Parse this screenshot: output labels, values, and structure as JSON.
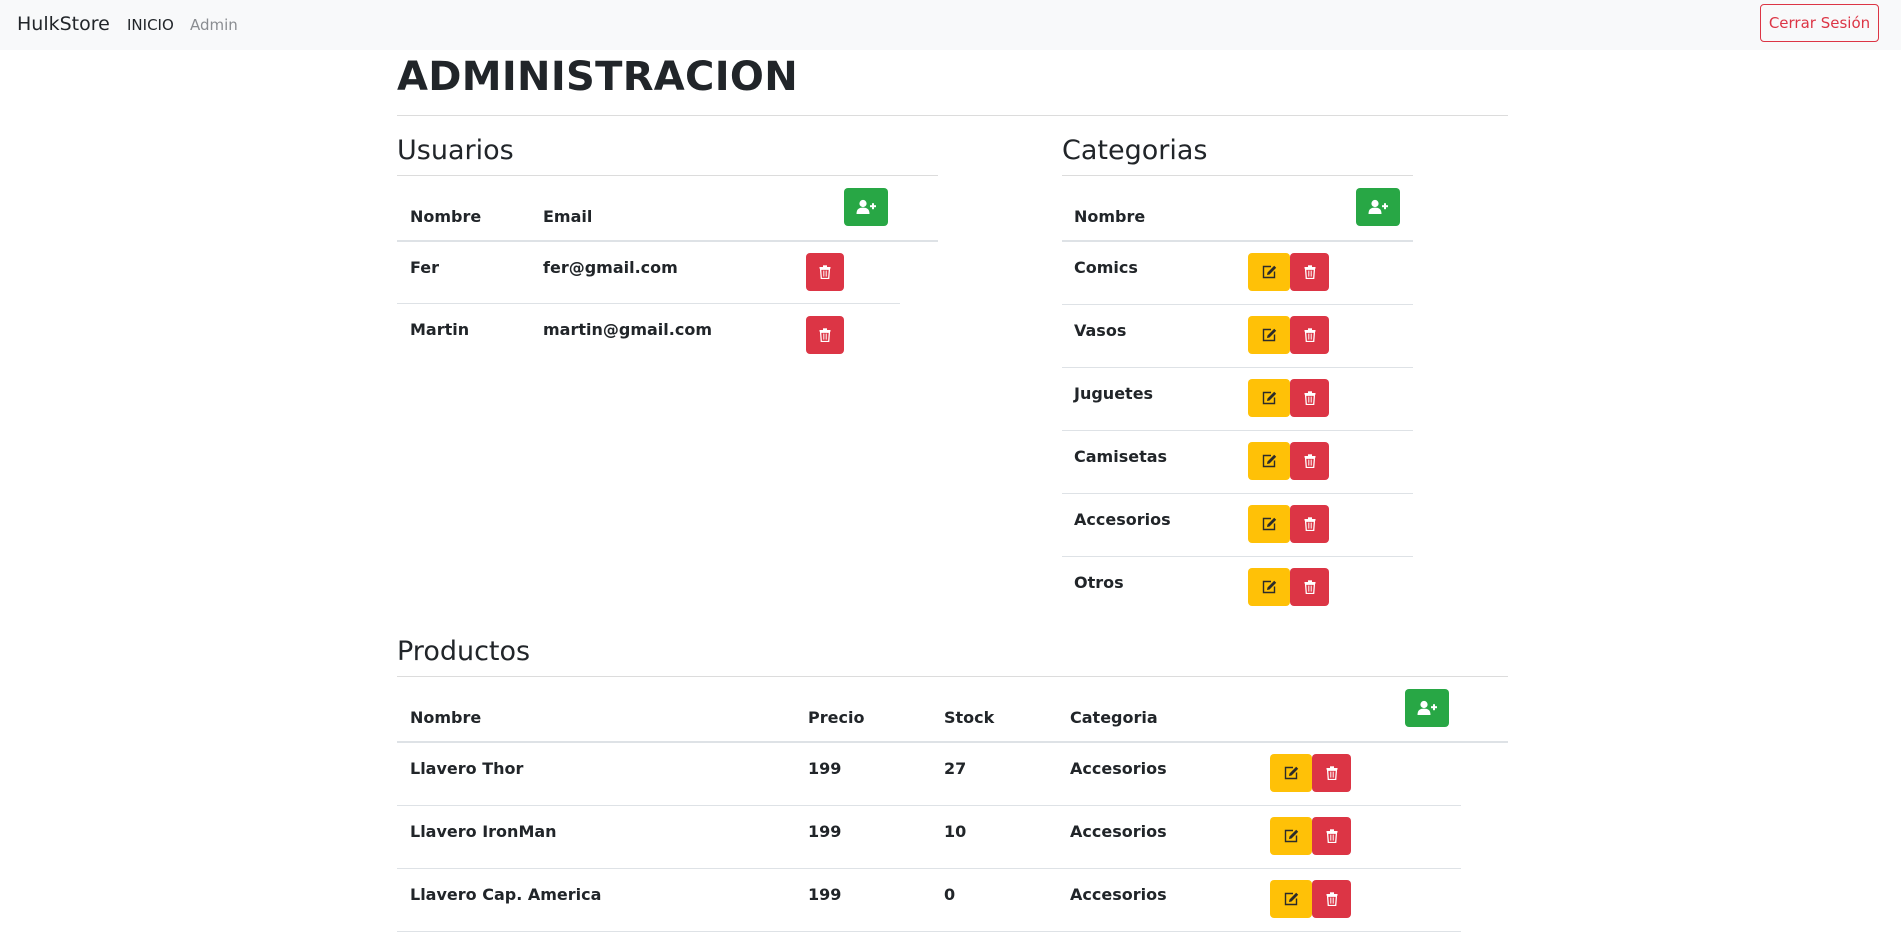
{
  "navbar": {
    "brand": "HulkStore",
    "links": [
      "INICIO",
      "Admin"
    ],
    "logout_label": "Cerrar Sesión"
  },
  "page_title": "ADMINISTRACION",
  "usuarios": {
    "title": "Usuarios",
    "headers": [
      "Nombre",
      "Email"
    ],
    "rows": [
      {
        "nombre": "Fer",
        "email": "fer@gmail.com"
      },
      {
        "nombre": "Martin",
        "email": "martin@gmail.com"
      }
    ]
  },
  "categorias": {
    "title": "Categorias",
    "headers": [
      "Nombre"
    ],
    "rows": [
      "Comics",
      "Vasos",
      "Juguetes",
      "Camisetas",
      "Accesorios",
      "Otros"
    ]
  },
  "productos": {
    "title": "Productos",
    "headers": [
      "Nombre",
      "Precio",
      "Stock",
      "Categoria"
    ],
    "rows": [
      {
        "nombre": "Llavero Thor",
        "precio": "199",
        "stock": "27",
        "categoria": "Accesorios"
      },
      {
        "nombre": "Llavero IronMan",
        "precio": "199",
        "stock": "10",
        "categoria": "Accesorios"
      },
      {
        "nombre": "Llavero Cap. America",
        "precio": "199",
        "stock": "0",
        "categoria": "Accesorios"
      }
    ]
  },
  "icons": {
    "add": "user-plus-icon",
    "edit": "edit-icon",
    "delete": "trash-icon"
  },
  "colors": {
    "success": "#28a745",
    "danger": "#dc3545",
    "warning": "#ffc107",
    "navbar_bg": "#f8f9fa"
  }
}
